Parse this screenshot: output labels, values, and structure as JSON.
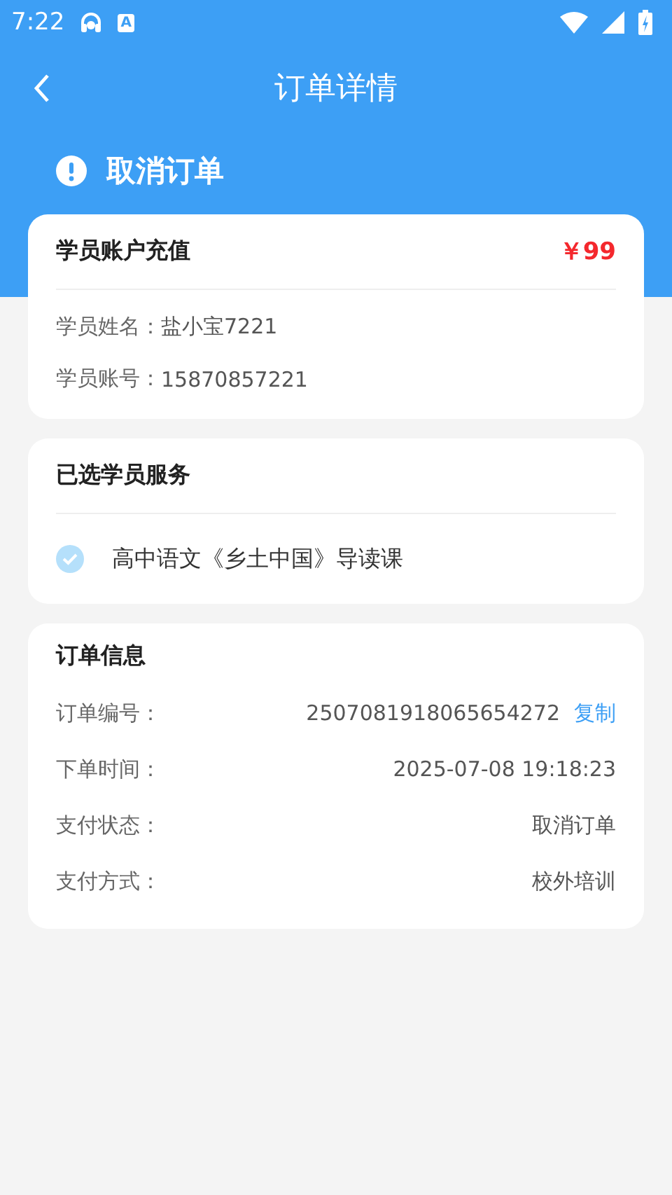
{
  "status_bar": {
    "time": "7:22",
    "notification_letter": "A"
  },
  "nav": {
    "title": "订单详情"
  },
  "order_status": {
    "text": "取消订单"
  },
  "recharge_card": {
    "title": "学员账户充值",
    "price": "￥99",
    "rows": [
      {
        "label": "学员姓名：",
        "value": "盐小宝7221"
      },
      {
        "label": "学员账号：",
        "value": "15870857221"
      }
    ]
  },
  "service_card": {
    "title": "已选学员服务",
    "items": [
      {
        "name": "高中语文《乡土中国》导读课",
        "checked": true
      }
    ]
  },
  "info_card": {
    "title": "订单信息",
    "rows": [
      {
        "label": "订单编号：",
        "value": "2507081918065654272",
        "action": "复制"
      },
      {
        "label": "下单时间：",
        "value": "2025-07-08 19:18:23"
      },
      {
        "label": "支付状态：",
        "value": "取消订单"
      },
      {
        "label": "支付方式：",
        "value": "校外培训"
      }
    ]
  }
}
